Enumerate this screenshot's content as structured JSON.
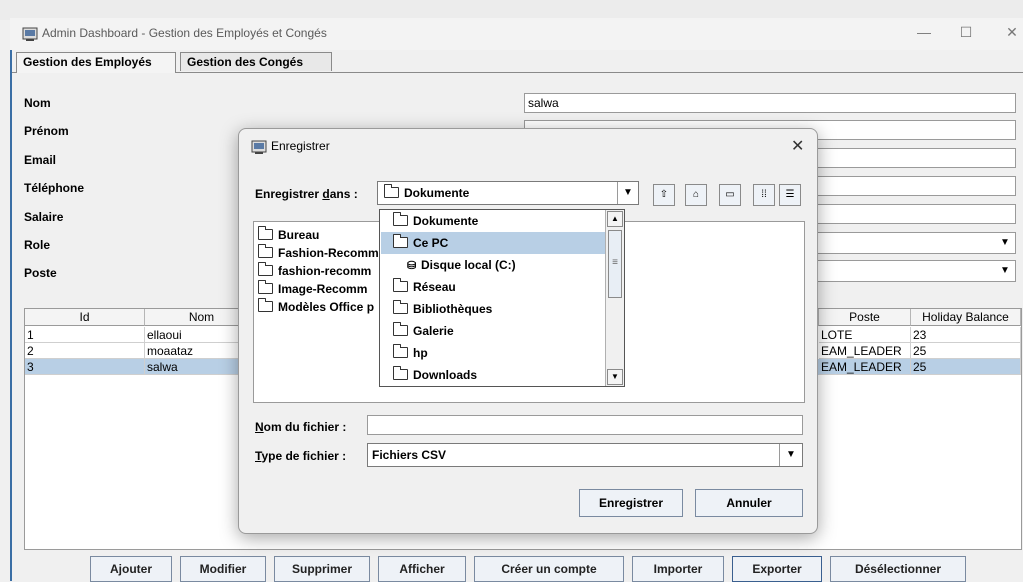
{
  "window": {
    "title": "Admin Dashboard - Gestion des Employés et Congés"
  },
  "tabs": [
    {
      "label": "Gestion des Employés"
    },
    {
      "label": "Gestion des Congés"
    }
  ],
  "form": {
    "nom_label": "Nom",
    "prenom_label": "Prénom",
    "email_label": "Email",
    "telephone_label": "Téléphone",
    "salaire_label": "Salaire",
    "role_label": "Role",
    "poste_label": "Poste",
    "nom_value": "salwa"
  },
  "table": {
    "headers": {
      "id": "Id",
      "nom": "Nom",
      "poste": "Poste",
      "holiday": "Holiday Balance"
    },
    "rows": [
      {
        "id": "1",
        "nom": "ellaoui",
        "poste": "LOTE",
        "holiday": "23"
      },
      {
        "id": "2",
        "nom": "moaataz",
        "poste": "EAM_LEADER",
        "holiday": "25"
      },
      {
        "id": "3",
        "nom": "salwa",
        "poste": "EAM_LEADER",
        "holiday": "25"
      }
    ]
  },
  "buttons": {
    "ajouter": "Ajouter",
    "modifier": "Modifier",
    "supprimer": "Supprimer",
    "afficher": "Afficher",
    "creer": "Créer un compte",
    "importer": "Importer",
    "exporter": "Exporter",
    "deselectionner": "Désélectionner"
  },
  "dialog": {
    "title": "Enregistrer",
    "save_in_label_pre": "Enregistrer ",
    "save_in_label_u": "d",
    "save_in_label_post": "ans :",
    "save_in_value": "Dokumente",
    "files": [
      "Bureau",
      "Fashion-Recomm",
      "fashion-recomm",
      "Image-Recomm",
      "Modèles Office p"
    ],
    "dropdown": [
      "Dokumente",
      "Ce PC",
      "Disque local (C:)",
      "Réseau",
      "Bibliothèques",
      "Galerie",
      "hp",
      "Downloads"
    ],
    "filename_label_u": "N",
    "filename_label_rest": "om du fichier :",
    "filename_value": "",
    "filetype_label_u": "T",
    "filetype_label_rest": "ype de fichier :",
    "filetype_value": "Fichiers CSV",
    "save_button": "Enregistrer",
    "cancel_button": "Annuler"
  }
}
